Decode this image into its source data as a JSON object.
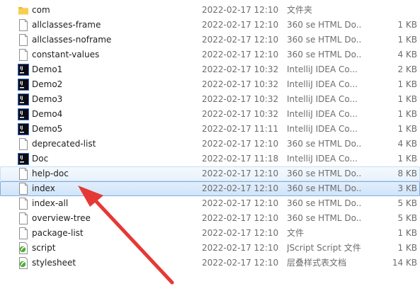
{
  "files": [
    {
      "name": "com",
      "date": "2022-02-17 12:10",
      "type": "文件夹",
      "size": "",
      "icon": "folder-icon"
    },
    {
      "name": "allclasses-frame",
      "date": "2022-02-17 12:10",
      "type": "360 se HTML Do...",
      "size": "1 KB",
      "icon": "html-file-icon"
    },
    {
      "name": "allclasses-noframe",
      "date": "2022-02-17 12:10",
      "type": "360 se HTML Do...",
      "size": "1 KB",
      "icon": "html-file-icon"
    },
    {
      "name": "constant-values",
      "date": "2022-02-17 12:10",
      "type": "360 se HTML Do...",
      "size": "4 KB",
      "icon": "html-file-icon"
    },
    {
      "name": "Demo1",
      "date": "2022-02-17 10:32",
      "type": "IntelliJ IDEA Co...",
      "size": "2 KB",
      "icon": "intellij-file-icon"
    },
    {
      "name": "Demo2",
      "date": "2022-02-17 10:32",
      "type": "IntelliJ IDEA Co...",
      "size": "1 KB",
      "icon": "intellij-file-icon"
    },
    {
      "name": "Demo3",
      "date": "2022-02-17 10:32",
      "type": "IntelliJ IDEA Co...",
      "size": "1 KB",
      "icon": "intellij-file-icon"
    },
    {
      "name": "Demo4",
      "date": "2022-02-17 10:32",
      "type": "IntelliJ IDEA Co...",
      "size": "1 KB",
      "icon": "intellij-file-icon"
    },
    {
      "name": "Demo5",
      "date": "2022-02-17 11:11",
      "type": "IntelliJ IDEA Co...",
      "size": "1 KB",
      "icon": "intellij-file-icon"
    },
    {
      "name": "deprecated-list",
      "date": "2022-02-17 12:10",
      "type": "360 se HTML Do...",
      "size": "4 KB",
      "icon": "html-file-icon"
    },
    {
      "name": "Doc",
      "date": "2022-02-17 11:18",
      "type": "IntelliJ IDEA Co...",
      "size": "1 KB",
      "icon": "intellij-file-icon"
    },
    {
      "name": "help-doc",
      "date": "2022-02-17 12:10",
      "type": "360 se HTML Do...",
      "size": "8 KB",
      "icon": "html-file-icon",
      "state": "hover"
    },
    {
      "name": "index",
      "date": "2022-02-17 12:10",
      "type": "360 se HTML Do...",
      "size": "3 KB",
      "icon": "html-file-icon",
      "state": "selected"
    },
    {
      "name": "index-all",
      "date": "2022-02-17 12:10",
      "type": "360 se HTML Do...",
      "size": "5 KB",
      "icon": "html-file-icon"
    },
    {
      "name": "overview-tree",
      "date": "2022-02-17 12:10",
      "type": "360 se HTML Do...",
      "size": "5 KB",
      "icon": "html-file-icon"
    },
    {
      "name": "package-list",
      "date": "2022-02-17 12:10",
      "type": "文件",
      "size": "1 KB",
      "icon": "generic-file-icon"
    },
    {
      "name": "script",
      "date": "2022-02-17 12:10",
      "type": "JScript Script 文件",
      "size": "1 KB",
      "icon": "script-file-icon"
    },
    {
      "name": "stylesheet",
      "date": "2022-02-17 12:10",
      "type": "层叠样式表文档",
      "size": "14 KB",
      "icon": "script-file-icon"
    }
  ],
  "annotation": {
    "arrow_color": "#e53935"
  },
  "colors": {
    "selection": "#cfe4fa",
    "hover": "#e8f2fb",
    "text": "#1e1e1e",
    "meta": "#6d6d6d"
  }
}
